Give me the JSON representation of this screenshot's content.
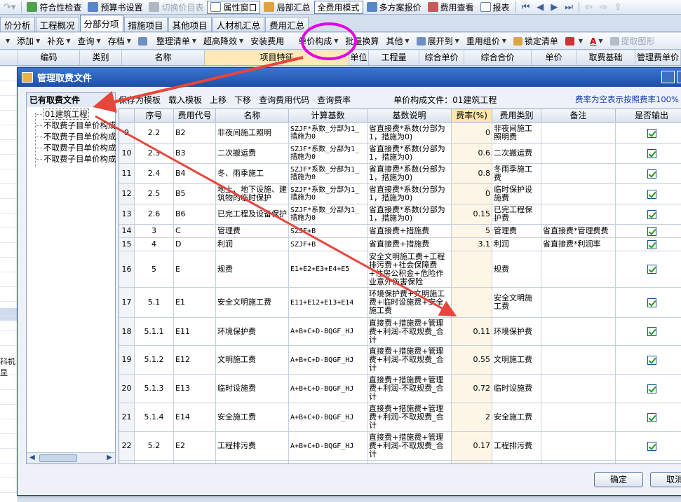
{
  "toolbar1": {
    "items": [
      {
        "label": "符合性检查",
        "icon": "check-icon",
        "state": "normal"
      },
      {
        "label": "预算书设置",
        "icon": "settings-icon",
        "state": "normal"
      },
      {
        "label": "切换价目表",
        "icon": "switch-icon",
        "state": "disabled"
      },
      {
        "label": "属性窗口",
        "icon": "window-icon",
        "state": "selected"
      },
      {
        "label": "局部汇总",
        "icon": "sum-icon",
        "state": "normal"
      },
      {
        "label": "全费用模式",
        "icon": "",
        "state": "selected"
      },
      {
        "label": "多方案报价",
        "icon": "scheme-icon",
        "state": "normal"
      },
      {
        "label": "费用查看",
        "icon": "view-icon",
        "state": "normal"
      },
      {
        "label": "报表",
        "icon": "report-icon",
        "state": "normal"
      }
    ]
  },
  "tabs": {
    "items": [
      "价分析",
      "工程概况",
      "分部分项",
      "措施项目",
      "其他项目",
      "人材机汇总",
      "费用汇总"
    ],
    "active": "分部分项"
  },
  "toolbar3": {
    "items": [
      "添加",
      "补充",
      "查询",
      "存档",
      "整理清单",
      "超高降效",
      "安装费用",
      "单价构成",
      "批量换算",
      "其他",
      "展开到",
      "重用组价",
      "锁定清单"
    ],
    "extra": "提取图形"
  },
  "bg_header": [
    "编码",
    "类别",
    "名称",
    "项目特征",
    "单位",
    "工程量",
    "综合单价",
    "综合合价",
    "单价",
    "取费基础",
    "管理费单价"
  ],
  "bg_side_label": "科机显",
  "dialog": {
    "title": "管理取费文件",
    "left_title": "已有取费文件",
    "tree": [
      "01建筑工程",
      "不取费子目单价构成",
      "不取费子目单价构成",
      "不取费子目单价构成",
      "不取费子目单价构成"
    ],
    "toolbar": [
      "保存为模板",
      "载入模板",
      "上移",
      "下移",
      "查询费用代码",
      "查询费率"
    ],
    "doc_label": "单价构成文件：01建筑工程",
    "rate_note": "费率为空表示按照费率100%",
    "columns": [
      "序号",
      "费用代号",
      "名称",
      "计算基数",
      "基数说明",
      "费率(%)",
      "费用类别",
      "备注",
      "是否输出"
    ],
    "rows": [
      [
        "9",
        "2.2",
        "B2",
        "非夜间施工照明",
        "SZJF*系数_分部为1_措施为0",
        "省直接费*系数(分部为1，措施为0)",
        "0",
        "非夜间施工照明费",
        "",
        true
      ],
      [
        "10",
        "2.3",
        "B3",
        "二次搬运费",
        "SZJF*系数_分部为1_措施为0",
        "省直接费*系数(分部为1，措施为0)",
        "0.6",
        "二次搬运费",
        "",
        true
      ],
      [
        "11",
        "2.4",
        "B4",
        "冬、雨季施工",
        "SZJF*系数_分部为1_措施为0",
        "省直接费*系数(分部为1，措施为0)",
        "0.8",
        "冬雨季施工费",
        "",
        true
      ],
      [
        "12",
        "2.5",
        "B5",
        "地上、地下设施、建筑物的临时保护",
        "SZJF*系数_分部为1_措施为0",
        "省直接费*系数(分部为1，措施为0)",
        "0",
        "临时保护设施费",
        "",
        true
      ],
      [
        "13",
        "2.6",
        "B6",
        "已完工程及设备保护",
        "SZJF*系数_分部为1_措施为0",
        "省直接费*系数(分部为1，措施为0)",
        "0.15",
        "已完工程保护费",
        "",
        true
      ],
      [
        "14",
        "3",
        "C",
        "管理费",
        "SZJF+B",
        "省直接费+措施费",
        "5",
        "管理费",
        "省直接费*管理费费",
        true
      ],
      [
        "15",
        "4",
        "D",
        "利润",
        "SZJF+B",
        "省直接费+措施费",
        "3.1",
        "利润",
        "省直接费*利润率",
        true
      ],
      [
        "16",
        "5",
        "E",
        "规费",
        "E1+E2+E3+E4+E5",
        "安全文明施工费+工程排污费+社会保障费+住房公积金+危险作业意外伤害保险",
        "",
        "规费",
        "",
        true
      ],
      [
        "17",
        "5.1",
        "E1",
        "安全文明施工费",
        "E11+E12+E13+E14",
        "环境保护费+文明施工费+临时设施费+安全施工费",
        "",
        "安全文明施工费",
        "",
        true
      ],
      [
        "18",
        "5.1.1",
        "E11",
        "环境保护费",
        "A+B+C+D-BQGF_HJ",
        "直接费+措施费+管理费+利润-不取规费_合计",
        "0.11",
        "环境保护费",
        "",
        true
      ],
      [
        "19",
        "5.1.2",
        "E12",
        "文明施工费",
        "A+B+C+D-BQGF_HJ",
        "直接费+措施费+管理费+利润-不取规费_合计",
        "0.55",
        "文明施工费",
        "",
        true
      ],
      [
        "20",
        "5.1.3",
        "E13",
        "临时设施费",
        "A+B+C+D-BQGF_HJ",
        "直接费+措施费+管理费+利润-不取规费_合计",
        "0.72",
        "临时设施费",
        "",
        true
      ],
      [
        "21",
        "5.1.4",
        "E14",
        "安全施工费",
        "A+B+C+D-BQGF_HJ",
        "直接费+措施费+管理费+利润-不取规费_合计",
        "2",
        "安全施工费",
        "",
        true
      ],
      [
        "22",
        "5.2",
        "E2",
        "工程排污费",
        "A+B+C+D-BQGF_HJ",
        "直接费+措施费+管理费+利润-不取规费_合计",
        "0.17",
        "工程排污费",
        "",
        true
      ],
      [
        "",
        "",
        "",
        "",
        "",
        "直接费+措施费+管理",
        "",
        "",
        "",
        false
      ]
    ],
    "ok_label": "确定",
    "cancel_label": "取消"
  },
  "colors": {
    "title_bar": "#1d4fa8",
    "annotation_ellipse": "#e400e4",
    "annotation_arrow": "#e8453c",
    "checkbox_tick": "#19a019"
  }
}
